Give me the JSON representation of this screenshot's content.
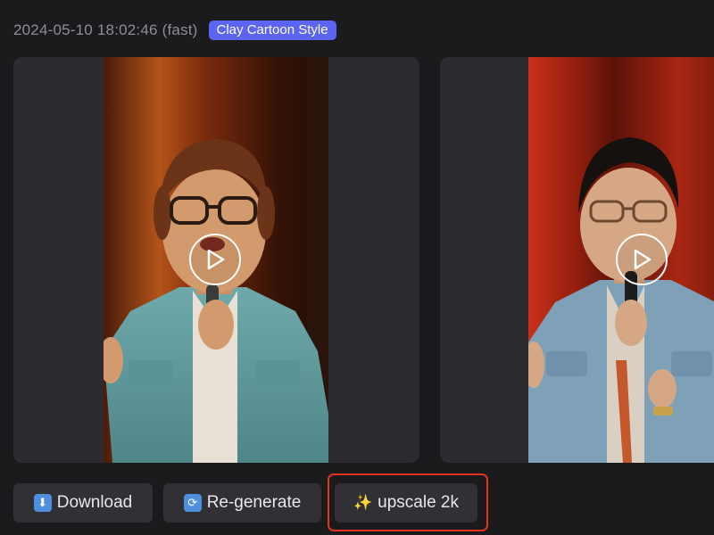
{
  "header": {
    "timestamp": "2024-05-10 18:02:46 (fast)",
    "style_badge": "Clay Cartoon Style"
  },
  "media": [
    {
      "kind": "video",
      "style": "clay cartoon render",
      "play_icon": "play-circle-icon"
    },
    {
      "kind": "video",
      "style": "original photo",
      "play_icon": "play-circle-icon"
    }
  ],
  "actions": {
    "download": {
      "icon": "download-arrow-icon",
      "label": "Download"
    },
    "regenerate": {
      "icon": "refresh-icon",
      "label": "Re-generate"
    },
    "upscale": {
      "icon": "sparkles-icon",
      "label": "upscale 2k"
    }
  },
  "colors": {
    "background": "#1b1b1e",
    "badge": "#5b64f3",
    "button": "#303035",
    "highlight": "#e5331e"
  }
}
